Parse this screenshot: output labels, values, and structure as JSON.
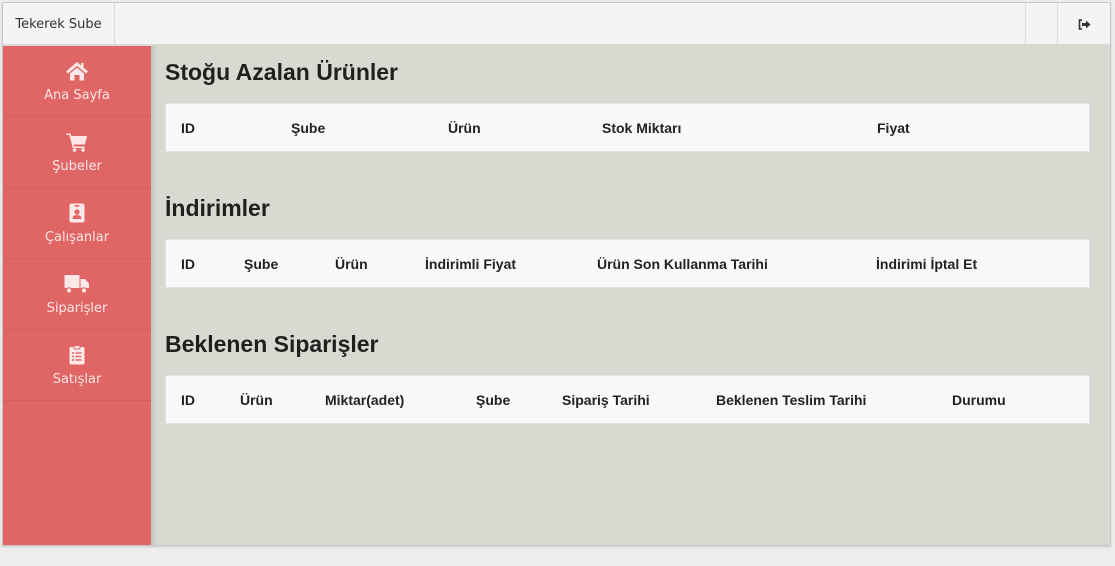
{
  "topbar": {
    "brand": "Tekerek Sube",
    "logout_icon": "sign-out-icon"
  },
  "sidebar": {
    "items": [
      {
        "label": "Ana Sayfa",
        "icon": "home-icon"
      },
      {
        "label": "Şubeler",
        "icon": "cart-icon"
      },
      {
        "label": "Çalışanlar",
        "icon": "id-badge-icon"
      },
      {
        "label": "Siparişler",
        "icon": "truck-icon"
      },
      {
        "label": "Satışlar",
        "icon": "clipboard-list-icon"
      }
    ]
  },
  "sections": {
    "low_stock": {
      "title": "Stoğu Azalan Ürünler",
      "columns": [
        "ID",
        "Şube",
        "Ürün",
        "Stok Miktarı",
        "Fiyat"
      ]
    },
    "discounts": {
      "title": "İndirimler",
      "columns": [
        "ID",
        "Şube",
        "Ürün",
        "İndirimli Fiyat",
        "Ürün Son Kullanma Tarihi",
        "İndirimi İptal Et"
      ]
    },
    "pending_orders": {
      "title": "Beklenen Siparişler",
      "columns": [
        "ID",
        "Ürün",
        "Miktar(adet)",
        "Şube",
        "Sipariş Tarihi",
        "Beklenen Teslim Tarihi",
        "Durumu"
      ]
    }
  },
  "colors": {
    "sidebar": "#e06666",
    "content_bg": "#d8d9d1",
    "table_bg": "#f8f9fa"
  }
}
